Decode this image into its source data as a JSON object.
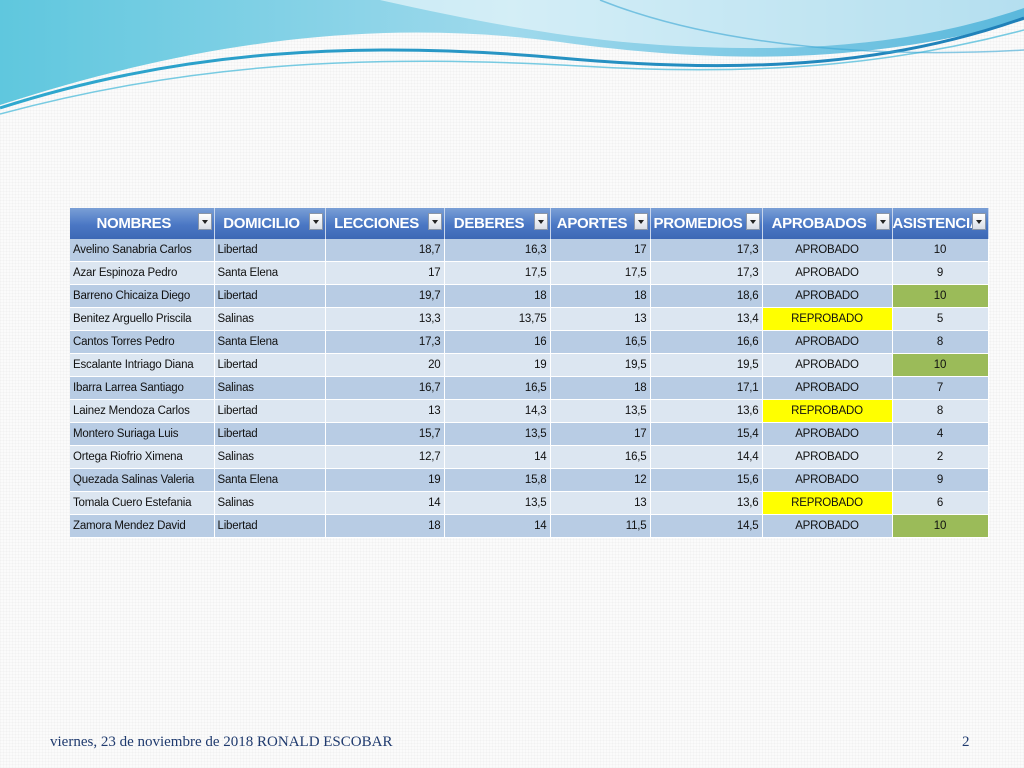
{
  "columns": [
    "NOMBRES",
    "DOMICILIO",
    "LECCIONES",
    "DEBERES",
    "APORTES",
    "PROMEDIOS",
    "APROBADOS",
    "ASISTENCIA"
  ],
  "rows": [
    [
      "Avelino Sanabria Carlos",
      "Libertad",
      "18,7",
      "16,3",
      "17",
      "17,3",
      "APROBADO",
      "10"
    ],
    [
      "Azar Espinoza Pedro",
      "Santa Elena",
      "17",
      "17,5",
      "17,5",
      "17,3",
      "APROBADO",
      "9"
    ],
    [
      "Barreno Chicaiza Diego",
      "Libertad",
      "19,7",
      "18",
      "18",
      "18,6",
      "APROBADO",
      "10"
    ],
    [
      "Benitez Arguello Priscila",
      "Salinas",
      "13,3",
      "13,75",
      "13",
      "13,4",
      "REPROBADO",
      "5"
    ],
    [
      "Cantos Torres  Pedro",
      "Santa Elena",
      "17,3",
      "16",
      "16,5",
      "16,6",
      "APROBADO",
      "8"
    ],
    [
      "Escalante Intriago Diana",
      "Libertad",
      "20",
      "19",
      "19,5",
      "19,5",
      "APROBADO",
      "10"
    ],
    [
      "Ibarra Larrea Santiago",
      "Salinas",
      "16,7",
      "16,5",
      "18",
      "17,1",
      "APROBADO",
      "7"
    ],
    [
      "Lainez Mendoza Carlos",
      "Libertad",
      "13",
      "14,3",
      "13,5",
      "13,6",
      "REPROBADO",
      "8"
    ],
    [
      "Montero Suriaga Luis",
      "Libertad",
      "15,7",
      "13,5",
      "17",
      "15,4",
      "APROBADO",
      "4"
    ],
    [
      "Ortega Riofrio Ximena",
      "Salinas",
      "12,7",
      "14",
      "16,5",
      "14,4",
      "APROBADO",
      "2"
    ],
    [
      "Quezada Salinas Valeria",
      "Santa Elena",
      "19",
      "15,8",
      "12",
      "15,6",
      "APROBADO",
      "9"
    ],
    [
      "Tomala Cuero Estefania",
      "Salinas",
      "14",
      "13,5",
      "13",
      "13,6",
      "REPROBADO",
      "6"
    ],
    [
      "Zamora Mendez David",
      "Libertad",
      "18",
      "14",
      "11,5",
      "14,5",
      "APROBADO",
      "10"
    ]
  ],
  "highlight_attendance_rows": [
    2,
    5,
    12
  ],
  "colors": {
    "header": "#4a77c4",
    "row_odd": "#b8cce4",
    "row_even": "#dce6f1",
    "reprobado": "#ffff00",
    "asistencia_highlight": "#9bbb59"
  },
  "footer": {
    "date_author": "viernes, 23 de noviembre de 2018  RONALD ESCOBAR",
    "page_number": "2"
  }
}
